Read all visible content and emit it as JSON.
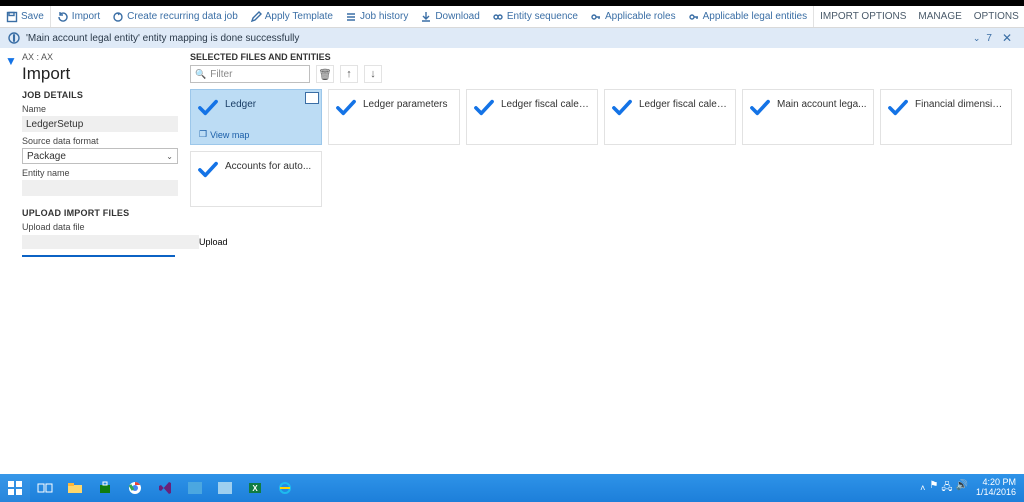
{
  "actionbar": {
    "save": "Save",
    "import": "Import",
    "create_recurring": "Create recurring data job",
    "apply_template": "Apply Template",
    "job_history": "Job history",
    "download": "Download",
    "entity_sequence": "Entity sequence",
    "applicable_roles": "Applicable roles",
    "applicable_legal_entities": "Applicable legal entities",
    "import_options": "IMPORT OPTIONS",
    "manage": "MANAGE",
    "options": "OPTIONS"
  },
  "notice": {
    "message": "'Main account legal entity' entity mapping is done successfully",
    "count": "7"
  },
  "left": {
    "breadcrumb": "AX : AX",
    "title": "Import",
    "job_details_hdr": "JOB DETAILS",
    "name_label": "Name",
    "name_value": "LedgerSetup",
    "source_label": "Source data format",
    "source_value": "Package",
    "entity_label": "Entity name",
    "entity_value": "",
    "upload_hdr": "UPLOAD IMPORT FILES",
    "upload_label": "Upload data file",
    "upload_btn": "Upload"
  },
  "main": {
    "selected_hdr": "SELECTED FILES AND ENTITIES",
    "filter_placeholder": "Filter",
    "view_map": "View map",
    "cards": [
      {
        "name": "Ledger",
        "selected": true
      },
      {
        "name": "Ledger parameters"
      },
      {
        "name": "Ledger fiscal calen..."
      },
      {
        "name": "Ledger fiscal calen..."
      },
      {
        "name": "Main account lega..."
      },
      {
        "name": "Financial dimensio..."
      },
      {
        "name": "Accounts for auto..."
      }
    ]
  },
  "taskbar": {
    "time": "4:20 PM",
    "date": "1/14/2016"
  }
}
